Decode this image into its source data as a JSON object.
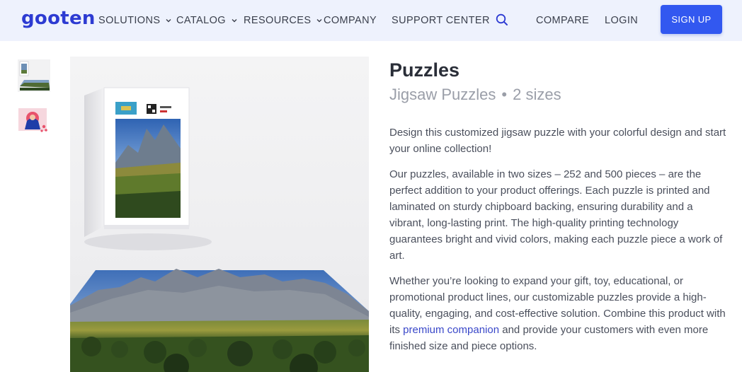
{
  "header": {
    "logo": "gooten",
    "nav": [
      {
        "label": "SOLUTIONS"
      },
      {
        "label": "CATALOG"
      },
      {
        "label": "RESOURCES"
      },
      {
        "label": "COMPANY"
      },
      {
        "label": "SUPPORT CENTER"
      }
    ],
    "compare_label": "COMPARE",
    "login_label": "LOGIN",
    "signup_label": "SIGN UP",
    "search_icon": "search-icon"
  },
  "colors": {
    "brand": "#2d3bd2",
    "header_bg": "#eef2fd",
    "signup_bg": "#3258f0",
    "link": "#3a48c9"
  },
  "product": {
    "title": "Puzzles",
    "subtitle_type": "Jigsaw Puzzles",
    "subtitle_separator": "•",
    "subtitle_sizes": "2 sizes",
    "description": {
      "p1": "Design this customized jigsaw puzzle with your colorful design and start your online collection!",
      "p2": "Our puzzles, available in two sizes – 252 and 500 pieces – are the perfect addition to your product offerings. Each puzzle is printed and laminated on sturdy chipboard backing, ensuring durability and a vibrant, long-lasting print. The high-quality printing technology guarantees bright and vivid colors, making each puzzle piece a work of art.",
      "p3_before": "Whether you’re looking to expand your gift, toy, educational, or promotional product lines, our customizable puzzles provide a high-quality, engaging, and cost-effective solution.  Combine this product with its ",
      "p3_link": "premium companion",
      "p3_after": " and provide your customers with even more finished size and piece options."
    }
  }
}
